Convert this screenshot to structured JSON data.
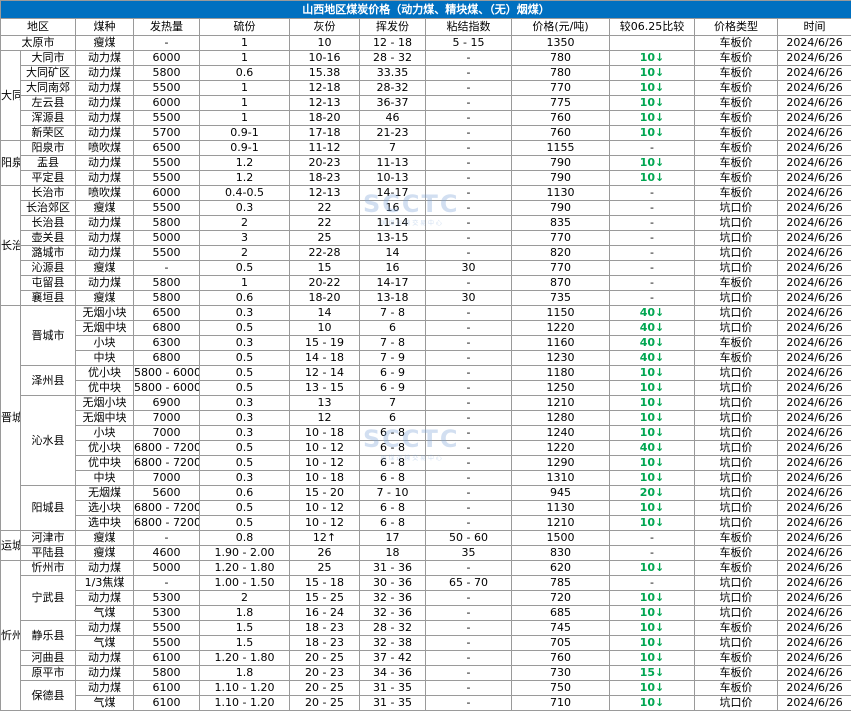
{
  "title": "山西地区煤炭价格（动力煤、精块煤、（无）烟煤）",
  "watermark": "SCCTC",
  "watermark_sub": "国 煤 运 输 交 易 中 心",
  "headers": [
    "地区",
    "煤种",
    "发热量",
    "硫份",
    "灰份",
    "挥发份",
    "粘结指数",
    "价格(元/吨)",
    "较06.25比较",
    "价格类型",
    "时间"
  ],
  "groups": [
    {
      "region": "",
      "rows": [
        {
          "sub": "太原市",
          "coal": "瘦煤",
          "heat": "-",
          "sulfur": "1",
          "ash": "10",
          "vol": "12 - 18",
          "bond": "5 - 15",
          "price": "1350",
          "diff": "",
          "type": "车板价",
          "date": "2024/6/26"
        }
      ]
    },
    {
      "region": "大同",
      "rows": [
        {
          "sub": "大同市",
          "coal": "动力煤",
          "heat": "6000",
          "sulfur": "1",
          "ash": "10-16",
          "vol": "28 - 32",
          "bond": "-",
          "price": "780",
          "diff": "10↓",
          "type": "车板价",
          "date": "2024/6/26"
        },
        {
          "sub": "大同矿区",
          "coal": "动力煤",
          "heat": "5800",
          "sulfur": "0.6",
          "ash": "15.38",
          "vol": "33.35",
          "bond": "-",
          "price": "780",
          "diff": "10↓",
          "type": "车板价",
          "date": "2024/6/26"
        },
        {
          "sub": "大同南郊",
          "coal": "动力煤",
          "heat": "5500",
          "sulfur": "1",
          "ash": "12-18",
          "vol": "28-32",
          "bond": "-",
          "price": "770",
          "diff": "10↓",
          "type": "车板价",
          "date": "2024/6/26"
        },
        {
          "sub": "左云县",
          "coal": "动力煤",
          "heat": "6000",
          "sulfur": "1",
          "ash": "12-13",
          "vol": "36-37",
          "bond": "-",
          "price": "775",
          "diff": "10↓",
          "type": "车板价",
          "date": "2024/6/26"
        },
        {
          "sub": "浑源县",
          "coal": "动力煤",
          "heat": "5500",
          "sulfur": "1",
          "ash": "18-20",
          "vol": "46",
          "bond": "-",
          "price": "760",
          "diff": "10↓",
          "type": "车板价",
          "date": "2024/6/26"
        },
        {
          "sub": "新荣区",
          "coal": "动力煤",
          "heat": "5700",
          "sulfur": "0.9-1",
          "ash": "17-18",
          "vol": "21-23",
          "bond": "-",
          "price": "760",
          "diff": "10↓",
          "type": "车板价",
          "date": "2024/6/26"
        }
      ]
    },
    {
      "region": "阳泉",
      "rows": [
        {
          "sub": "阳泉市",
          "coal": "喷吹煤",
          "heat": "6500",
          "sulfur": "0.9-1",
          "ash": "11-12",
          "vol": "7",
          "bond": "-",
          "price": "1155",
          "diff": "-",
          "type": "车板价",
          "date": "2024/6/26"
        },
        {
          "sub": "盂县",
          "coal": "动力煤",
          "heat": "5500",
          "sulfur": "1.2",
          "ash": "20-23",
          "vol": "11-13",
          "bond": "-",
          "price": "790",
          "diff": "10↓",
          "type": "车板价",
          "date": "2024/6/26"
        },
        {
          "sub": "平定县",
          "coal": "动力煤",
          "heat": "5500",
          "sulfur": "1.2",
          "ash": "18-23",
          "vol": "10-13",
          "bond": "-",
          "price": "790",
          "diff": "10↓",
          "type": "车板价",
          "date": "2024/6/26"
        }
      ]
    },
    {
      "region": "长治",
      "rows": [
        {
          "sub": "长治市",
          "coal": "喷吹煤",
          "heat": "6000",
          "sulfur": "0.4-0.5",
          "ash": "12-13",
          "vol": "14-17",
          "bond": "-",
          "price": "1130",
          "diff": "-",
          "type": "车板价",
          "date": "2024/6/26"
        },
        {
          "sub": "长治郊区",
          "coal": "瘦煤",
          "heat": "5500",
          "sulfur": "0.3",
          "ash": "22",
          "vol": "16",
          "bond": "-",
          "price": "790",
          "diff": "-",
          "type": "坑口价",
          "date": "2024/6/26"
        },
        {
          "sub": "长治县",
          "coal": "动力煤",
          "heat": "5800",
          "sulfur": "2",
          "ash": "22",
          "vol": "11-14",
          "bond": "-",
          "price": "835",
          "diff": "-",
          "type": "坑口价",
          "date": "2024/6/26"
        },
        {
          "sub": "壶关县",
          "coal": "动力煤",
          "heat": "5000",
          "sulfur": "3",
          "ash": "25",
          "vol": "13-15",
          "bond": "-",
          "price": "770",
          "diff": "-",
          "type": "坑口价",
          "date": "2024/6/26"
        },
        {
          "sub": "潞城市",
          "coal": "动力煤",
          "heat": "5500",
          "sulfur": "2",
          "ash": "22-28",
          "vol": "14",
          "bond": "-",
          "price": "820",
          "diff": "-",
          "type": "坑口价",
          "date": "2024/6/26"
        },
        {
          "sub": "沁源县",
          "coal": "瘦煤",
          "heat": "-",
          "sulfur": "0.5",
          "ash": "15",
          "vol": "16",
          "bond": "30",
          "price": "770",
          "diff": "-",
          "type": "坑口价",
          "date": "2024/6/26"
        },
        {
          "sub": "屯留县",
          "coal": "动力煤",
          "heat": "5800",
          "sulfur": "1",
          "ash": "20-22",
          "vol": "14-17",
          "bond": "-",
          "price": "870",
          "diff": "-",
          "type": "车板价",
          "date": "2024/6/26"
        },
        {
          "sub": "襄垣县",
          "coal": "瘦煤",
          "heat": "5800",
          "sulfur": "0.6",
          "ash": "18-20",
          "vol": "13-18",
          "bond": "30",
          "price": "735",
          "diff": "-",
          "type": "坑口价",
          "date": "2024/6/26"
        }
      ]
    },
    {
      "region": "晋城",
      "subgroups": [
        {
          "sub": "晋城市",
          "rows": [
            {
              "coal": "无烟小块",
              "heat": "6500",
              "sulfur": "0.3",
              "ash": "14",
              "vol": "7 - 8",
              "bond": "-",
              "price": "1150",
              "diff": "40↓",
              "type": "坑口价",
              "date": "2024/6/26"
            },
            {
              "coal": "无烟中块",
              "heat": "6800",
              "sulfur": "0.5",
              "ash": "10",
              "vol": "6",
              "bond": "-",
              "price": "1220",
              "diff": "40↓",
              "type": "坑口价",
              "date": "2024/6/26"
            },
            {
              "coal": "小块",
              "heat": "6300",
              "sulfur": "0.3",
              "ash": "15 - 19",
              "vol": "7 - 8",
              "bond": "-",
              "price": "1160",
              "diff": "40↓",
              "type": "车板价",
              "date": "2024/6/26"
            },
            {
              "coal": "中块",
              "heat": "6800",
              "sulfur": "0.5",
              "ash": "14 - 18",
              "vol": "7 - 9",
              "bond": "-",
              "price": "1230",
              "diff": "40↓",
              "type": "车板价",
              "date": "2024/6/26"
            }
          ]
        },
        {
          "sub": "泽州县",
          "rows": [
            {
              "coal": "优小块",
              "heat": "5800 - 6000",
              "sulfur": "0.5",
              "ash": "12 - 14",
              "vol": "6 - 9",
              "bond": "-",
              "price": "1180",
              "diff": "10↓",
              "type": "坑口价",
              "date": "2024/6/26"
            },
            {
              "coal": "优中块",
              "heat": "5800 - 6000",
              "sulfur": "0.5",
              "ash": "13 - 15",
              "vol": "6 - 9",
              "bond": "-",
              "price": "1250",
              "diff": "10↓",
              "type": "坑口价",
              "date": "2024/6/26"
            }
          ]
        },
        {
          "sub": "沁水县",
          "rows": [
            {
              "coal": "无烟小块",
              "heat": "6900",
              "sulfur": "0.3",
              "ash": "13",
              "vol": "7",
              "bond": "-",
              "price": "1210",
              "diff": "10↓",
              "type": "坑口价",
              "date": "2024/6/26"
            },
            {
              "coal": "无烟中块",
              "heat": "7000",
              "sulfur": "0.3",
              "ash": "12",
              "vol": "6",
              "bond": "-",
              "price": "1280",
              "diff": "10↓",
              "type": "坑口价",
              "date": "2024/6/26"
            },
            {
              "coal": "小块",
              "heat": "7000",
              "sulfur": "0.3",
              "ash": "10 - 18",
              "vol": "6 - 8",
              "bond": "-",
              "price": "1240",
              "diff": "10↓",
              "type": "坑口价",
              "date": "2024/6/26"
            },
            {
              "coal": "优小块",
              "heat": "6800 - 7200",
              "sulfur": "0.5",
              "ash": "10 - 12",
              "vol": "6 - 8",
              "bond": "-",
              "price": "1220",
              "diff": "40↓",
              "type": "坑口价",
              "date": "2024/6/26"
            },
            {
              "coal": "优中块",
              "heat": "6800 - 7200",
              "sulfur": "0.5",
              "ash": "10 - 12",
              "vol": "6 - 8",
              "bond": "-",
              "price": "1290",
              "diff": "10↓",
              "type": "坑口价",
              "date": "2024/6/26"
            },
            {
              "coal": "中块",
              "heat": "7000",
              "sulfur": "0.3",
              "ash": "10 - 18",
              "vol": "6 - 8",
              "bond": "-",
              "price": "1310",
              "diff": "10↓",
              "type": "坑口价",
              "date": "2024/6/26"
            }
          ]
        },
        {
          "sub": "阳城县",
          "rows": [
            {
              "coal": "无烟煤",
              "heat": "5600",
              "sulfur": "0.6",
              "ash": "15 - 20",
              "vol": "7 - 10",
              "bond": "-",
              "price": "945",
              "diff": "20↓",
              "type": "坑口价",
              "date": "2024/6/26"
            },
            {
              "coal": "选小块",
              "heat": "6800 - 7200",
              "sulfur": "0.5",
              "ash": "10 - 12",
              "vol": "6 - 8",
              "bond": "-",
              "price": "1130",
              "diff": "10↓",
              "type": "坑口价",
              "date": "2024/6/26"
            },
            {
              "coal": "选中块",
              "heat": "6800 - 7200",
              "sulfur": "0.5",
              "ash": "10 - 12",
              "vol": "6 - 8",
              "bond": "-",
              "price": "1210",
              "diff": "10↓",
              "type": "坑口价",
              "date": "2024/6/26"
            }
          ]
        }
      ]
    },
    {
      "region": "运城",
      "rows": [
        {
          "sub": "河津市",
          "coal": "瘦煤",
          "heat": "-",
          "sulfur": "0.8",
          "ash": "12↑",
          "vol": "17",
          "bond": "50 - 60",
          "price": "1500",
          "diff": "-",
          "type": "车板价",
          "date": "2024/6/26"
        },
        {
          "sub": "平陆县",
          "coal": "瘦煤",
          "heat": "4600",
          "sulfur": "1.90 - 2.00",
          "ash": "26",
          "vol": "18",
          "bond": "35",
          "price": "830",
          "diff": "-",
          "type": "车板价",
          "date": "2024/6/26"
        }
      ]
    },
    {
      "region": "忻州",
      "subgroups": [
        {
          "sub": "忻州市",
          "rows": [
            {
              "coal": "动力煤",
              "heat": "5000",
              "sulfur": "1.20 - 1.80",
              "ash": "25",
              "vol": "31 - 36",
              "bond": "-",
              "price": "620",
              "diff": "10↓",
              "type": "车板价",
              "date": "2024/6/26"
            }
          ]
        },
        {
          "sub": "宁武县",
          "rows": [
            {
              "coal": "1/3焦煤",
              "heat": "-",
              "sulfur": "1.00 - 1.50",
              "ash": "15 - 18",
              "vol": "30 - 36",
              "bond": "65 - 70",
              "price": "785",
              "diff": "-",
              "type": "坑口价",
              "date": "2024/6/26"
            },
            {
              "coal": "动力煤",
              "heat": "5300",
              "sulfur": "2",
              "ash": "15 - 25",
              "vol": "32 - 36",
              "bond": "-",
              "price": "720",
              "diff": "10↓",
              "type": "坑口价",
              "date": "2024/6/26"
            },
            {
              "coal": "气煤",
              "heat": "5300",
              "sulfur": "1.8",
              "ash": "16 - 24",
              "vol": "32 - 36",
              "bond": "-",
              "price": "685",
              "diff": "10↓",
              "type": "坑口价",
              "date": "2024/6/26"
            }
          ]
        },
        {
          "sub": "静乐县",
          "rows": [
            {
              "coal": "动力煤",
              "heat": "5500",
              "sulfur": "1.5",
              "ash": "18 - 23",
              "vol": "28 - 32",
              "bond": "-",
              "price": "745",
              "diff": "10↓",
              "type": "车板价",
              "date": "2024/6/26"
            },
            {
              "coal": "气煤",
              "heat": "5500",
              "sulfur": "1.5",
              "ash": "18 - 23",
              "vol": "32 - 38",
              "bond": "-",
              "price": "705",
              "diff": "10↓",
              "type": "坑口价",
              "date": "2024/6/26"
            }
          ]
        },
        {
          "sub": "河曲县",
          "rows": [
            {
              "coal": "动力煤",
              "heat": "6100",
              "sulfur": "1.20 - 1.80",
              "ash": "20 - 25",
              "vol": "37 - 42",
              "bond": "-",
              "price": "760",
              "diff": "10↓",
              "type": "车板价",
              "date": "2024/6/26"
            }
          ]
        },
        {
          "sub": "原平市",
          "rows": [
            {
              "coal": "动力煤",
              "heat": "5800",
              "sulfur": "1.8",
              "ash": "20 - 23",
              "vol": "34 - 36",
              "bond": "-",
              "price": "730",
              "diff": "15↓",
              "type": "车板价",
              "date": "2024/6/26"
            }
          ]
        },
        {
          "sub": "保德县",
          "rows": [
            {
              "coal": "动力煤",
              "heat": "6100",
              "sulfur": "1.10 - 1.20",
              "ash": "20 - 25",
              "vol": "31 - 35",
              "bond": "-",
              "price": "750",
              "diff": "10↓",
              "type": "车板价",
              "date": "2024/6/26"
            },
            {
              "coal": "气煤",
              "heat": "6100",
              "sulfur": "1.10 - 1.20",
              "ash": "20 - 25",
              "vol": "31 - 35",
              "bond": "-",
              "price": "710",
              "diff": "10↓",
              "type": "坑口价",
              "date": "2024/6/26"
            }
          ]
        }
      ]
    }
  ]
}
